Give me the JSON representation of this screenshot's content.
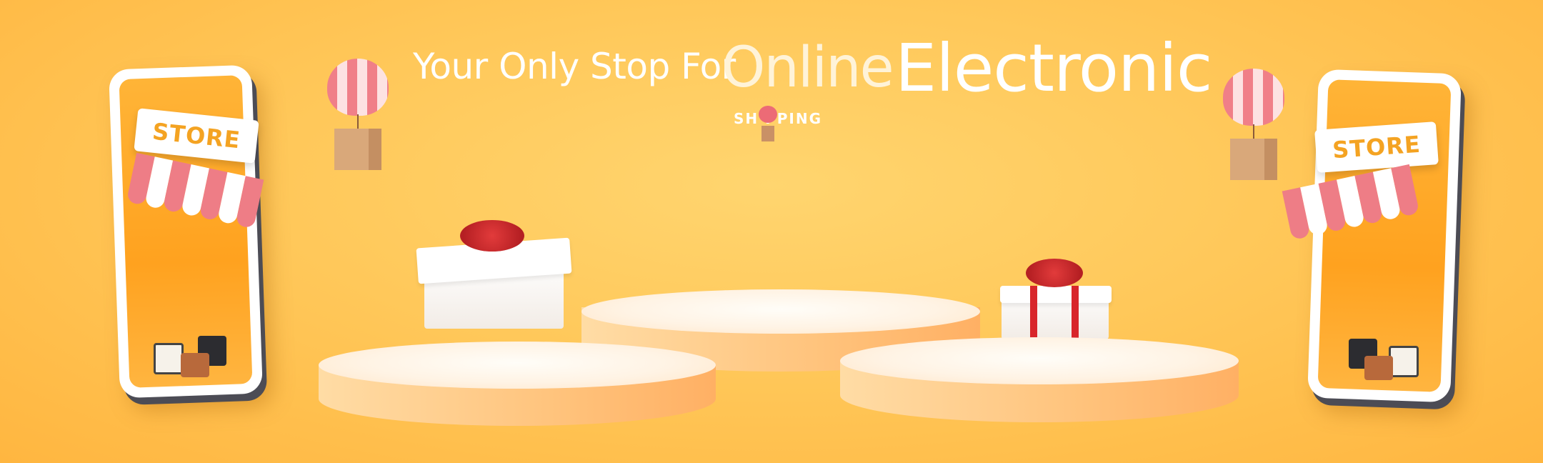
{
  "banner": {
    "headline_prefix": "Your Only Stop For",
    "headline_online": "Online",
    "headline_electronic": "Electronic",
    "shopping_label": "SH PPING"
  },
  "phones": {
    "left_store_label": "STORE",
    "right_store_label": "STORE"
  },
  "colors": {
    "background": "#ffc85a",
    "accent": "#ffa21f",
    "awning_stripe": "#ee7d86",
    "ribbon": "#d8262b"
  },
  "icons": [
    "balloon-icon",
    "parcel-icon",
    "shopping-cart-icon",
    "shopping-bag-icon",
    "calculator-icon",
    "gift-box-icon"
  ]
}
